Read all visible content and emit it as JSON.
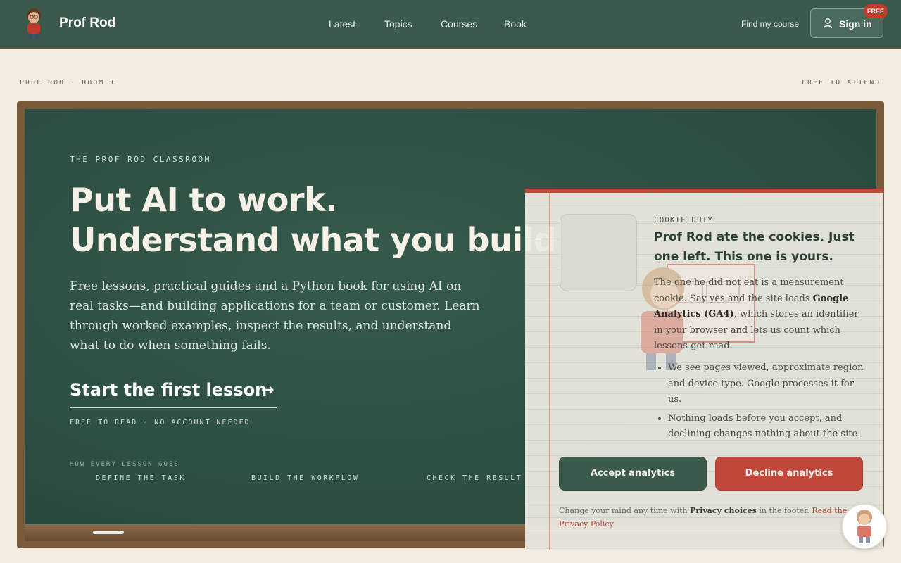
{
  "header": {
    "brand": "Prof Rod",
    "nav": [
      "Latest",
      "Topics",
      "Courses",
      "Book"
    ],
    "find_course": "Find my course",
    "sign_in": "Sign in",
    "free_badge": "FREE"
  },
  "page_meta": {
    "left": "PROF ROD · ROOM I",
    "right": "FREE TO ATTEND"
  },
  "hero": {
    "eyebrow": "THE PROF ROD CLASSROOM",
    "headline_line1": "Put AI to work.",
    "headline_line2": "Understand what you build.",
    "lead": "Free lessons, practical guides and a Python book for using AI on real tasks—and building applications for a team or customer. Learn through worked examples, inspect the results, and understand what to do when something fails.",
    "cta": "Start the first lesson",
    "cta_note": "FREE TO READ · NO ACCOUNT NEEDED",
    "steps_label": "HOW EVERY LESSON GOES",
    "steps": [
      "DEFINE THE TASK",
      "BUILD THE WORKFLOW",
      "CHECK THE RESULT"
    ]
  },
  "cookie": {
    "eyebrow": "COOKIE DUTY",
    "title": "Prof Rod ate the cookies. Just one left. This one is yours.",
    "body_pre": "The one he did not eat is a measurement cookie. Say yes and the site loads ",
    "body_bold": "Google Analytics (GA4)",
    "body_post": ", which stores an identifier in your browser and lets us count which lessons get read.",
    "bullets": [
      "We see pages viewed, approximate region and device type. Google processes it for us.",
      "Nothing loads before you accept, and declining changes nothing about the site."
    ],
    "accept": "Accept analytics",
    "decline": "Decline analytics",
    "foot_pre": "Change your mind any time with ",
    "foot_bold": "Privacy choices",
    "foot_mid": " in the footer. ",
    "foot_link": "Read the Privacy Policy"
  },
  "colors": {
    "header_green": "#3c5a4c",
    "board_green": "#2e4f43",
    "accent_red": "#c0473a",
    "paper": "#f3ece0"
  }
}
